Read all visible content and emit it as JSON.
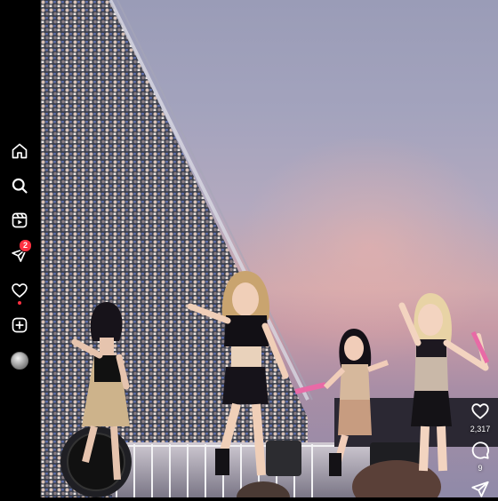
{
  "nav": {
    "items": [
      {
        "name": "home",
        "icon": "home-icon"
      },
      {
        "name": "search",
        "icon": "search-icon"
      },
      {
        "name": "reels",
        "icon": "reels-icon"
      },
      {
        "name": "messages",
        "icon": "send-icon",
        "badge": "2"
      },
      {
        "name": "notifications",
        "icon": "heart-icon",
        "has_dot": true
      },
      {
        "name": "create",
        "icon": "plus-square-icon"
      },
      {
        "name": "profile",
        "icon": "avatar"
      }
    ]
  },
  "reel": {
    "like_count": "2,317",
    "comment_count": "9"
  },
  "colors": {
    "badge": "#ff3040",
    "rail_background": "#000000",
    "icon": "#ffffff"
  }
}
